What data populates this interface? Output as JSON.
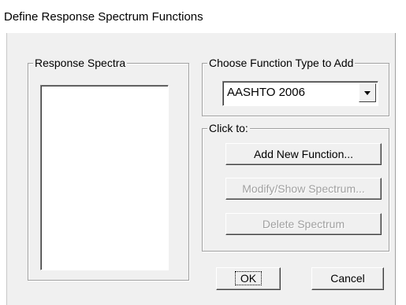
{
  "window": {
    "title": "Define Response Spectrum Functions"
  },
  "response_spectra": {
    "legend": "Response Spectra",
    "items": []
  },
  "function_type": {
    "legend": "Choose  Function Type to Add",
    "selected": "AASHTO 2006"
  },
  "actions": {
    "legend": "Click to:",
    "add_new_function": "Add New Function...",
    "modify_show_spectrum": "Modify/Show Spectrum...",
    "delete_spectrum": "Delete Spectrum"
  },
  "dialog_buttons": {
    "ok": "OK",
    "cancel": "Cancel"
  }
}
